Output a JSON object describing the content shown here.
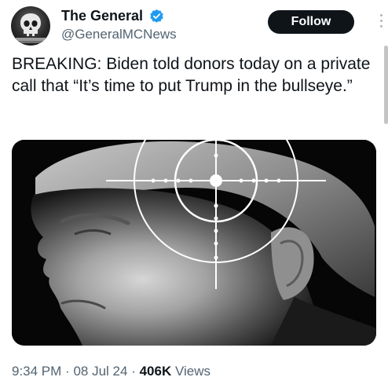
{
  "author": {
    "display_name": "The General",
    "handle": "@GeneralMCNews",
    "verified": true,
    "verified_color": "#1d9bf0",
    "avatar_icon": "skull-avatar-icon"
  },
  "actions": {
    "follow_label": "Follow",
    "more_icon": "more-vertical-icon"
  },
  "tweet": {
    "text": "BREAKING: Biden told donors today on a private call that “It’s time to put Trump in the bullseye.”"
  },
  "media": {
    "description_icon": "crosshair-icon"
  },
  "meta": {
    "time": "9:34 PM",
    "separator": "·",
    "date": "08 Jul 24",
    "views_count": "406K",
    "views_label": "Views"
  },
  "colors": {
    "follow_bg": "#0f1419",
    "secondary_text": "#536471"
  }
}
